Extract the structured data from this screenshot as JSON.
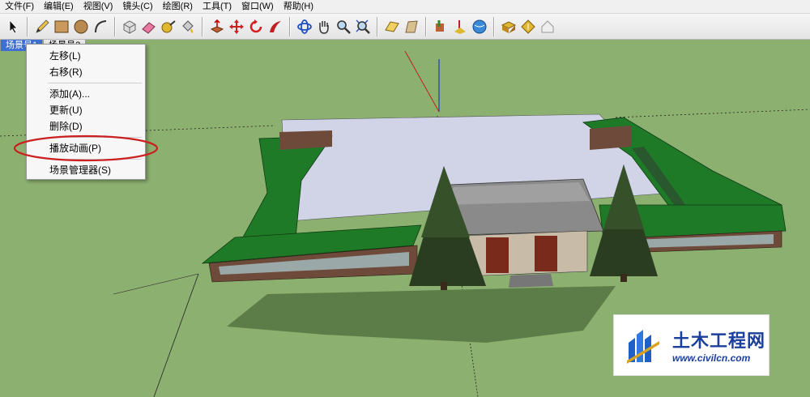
{
  "menubar": {
    "items": [
      "文件(F)",
      "编辑(E)",
      "视图(V)",
      "镜头(C)",
      "绘图(R)",
      "工具(T)",
      "窗口(W)",
      "帮助(H)"
    ]
  },
  "toolbar": {
    "icons": [
      "select-arrow",
      "pencil",
      "rectangle",
      "circle",
      "arc",
      "eraser",
      "paint-bucket",
      "tape-measure",
      "push-pull",
      "move",
      "rotate",
      "follow-me",
      "orbit",
      "pan",
      "zoom",
      "zoom-extents",
      "scene-camera",
      "walk",
      "position-camera",
      "look-around",
      "geo-location",
      "components",
      "warehouse",
      "extension"
    ]
  },
  "scene_tabs": {
    "active": "场景号1",
    "second": "场景号2"
  },
  "context_menu": {
    "items": {
      "move_left": "左移(L)",
      "move_right": "右移(R)",
      "add": "添加(A)...",
      "update": "更新(U)",
      "delete": "删除(D)",
      "play_animation": "播放动画(P)",
      "scene_manager": "场景管理器(S)"
    },
    "highlight_color": "#cc1f1f"
  },
  "watermark": {
    "title": "土木工程网",
    "url": "www.civilcn.com"
  },
  "colors": {
    "ground": "#8cb070",
    "roof": "#1f7a28",
    "courtyard": "#d0d4e6",
    "tree": "#2a3d20",
    "accent_blue": "#1a3f9c"
  }
}
